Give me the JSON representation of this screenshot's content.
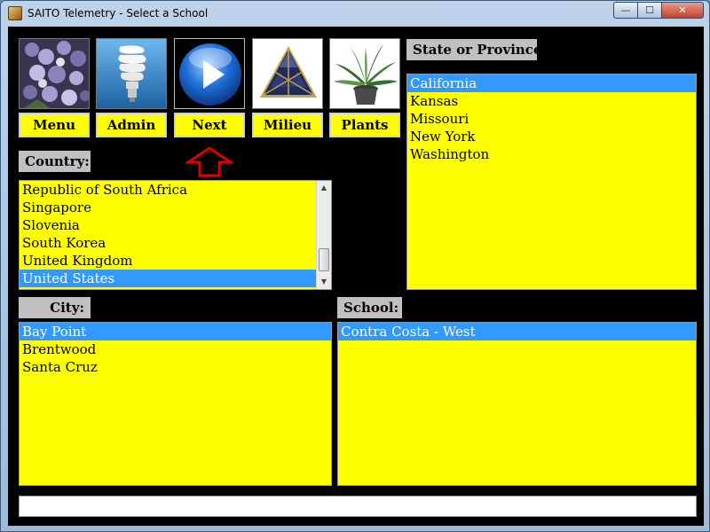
{
  "window": {
    "title": "SAITO Telemetry - Select a School",
    "min_glyph": "—",
    "max_glyph": "☐",
    "close_glyph": "✕"
  },
  "nav": [
    {
      "label": "Menu",
      "icon": "flowers-photo-icon"
    },
    {
      "label": "Admin",
      "icon": "lightbulb-icon"
    },
    {
      "label": "Next",
      "icon": "play-button-icon"
    },
    {
      "label": "Milieu",
      "icon": "triangle-logo-icon"
    },
    {
      "label": "Plants",
      "icon": "potted-plant-icon"
    }
  ],
  "pointer": {
    "icon": "red-up-arrow-icon",
    "color": "#e00000"
  },
  "country": {
    "label": "Country:",
    "items": [
      "Republic of South Africa",
      "Singapore",
      "Slovenia",
      "South Korea",
      "United Kingdom",
      "United States"
    ],
    "selected": "United States"
  },
  "state": {
    "label": "State or Province:",
    "items": [
      "California",
      "Kansas",
      "Missouri",
      "New York",
      "Washington"
    ],
    "selected": "California"
  },
  "city": {
    "label": "City:",
    "items": [
      "Bay Point",
      "Brentwood",
      "Santa Cruz"
    ],
    "selected": "Bay Point"
  },
  "school": {
    "label": "School:",
    "items": [
      "Contra Costa - West"
    ],
    "selected": "Contra Costa - West"
  },
  "status": {
    "text": ""
  },
  "colors": {
    "list_bg": "#ffff00",
    "selection": "#3399ff",
    "label_bg": "#c0c0c0",
    "client_bg": "#000000"
  }
}
